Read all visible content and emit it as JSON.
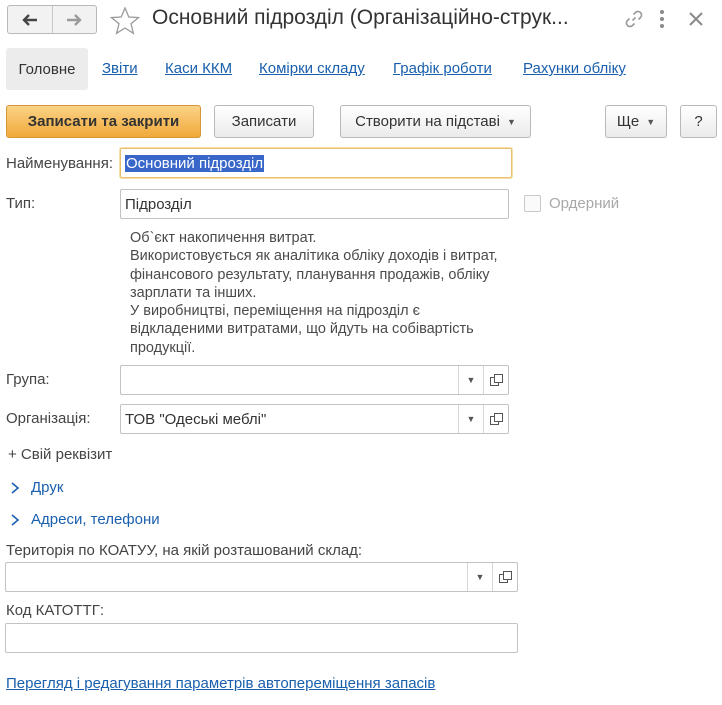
{
  "window": {
    "title": "Основний підрозділ (Організаційно-струк..."
  },
  "tabs": [
    {
      "label": "Головне",
      "active": true
    },
    {
      "label": "Звіти"
    },
    {
      "label": "Каси ККМ"
    },
    {
      "label": "Комірки складу"
    },
    {
      "label": "Графік роботи"
    },
    {
      "label": "Рахунки обліку"
    }
  ],
  "toolbar": {
    "save_close": "Записати та закрити",
    "save": "Записати",
    "create_based": "Створити на підставі",
    "more": "Ще",
    "help": "?"
  },
  "form": {
    "name_label": "Найменування:",
    "name_value": "Основний підрозділ",
    "type_label": "Тип:",
    "type_value": "Підрозділ",
    "orderly_label": "Ордерний",
    "orderly_checked": false,
    "description": "Об`єкт накопичення витрат.\nВикористовується як аналітика обліку доходів і витрат, фінансового результату, планування продажів, обліку зарплати та інших.\nУ виробництві, переміщення на підрозділ є відкладеними витратами, що йдуть на собівартість продукції.",
    "group_label": "Група:",
    "group_value": "",
    "org_label": "Організація:",
    "org_value": "ТОВ \"Одеські меблі\"",
    "custom_attr": "+ Свій реквізит",
    "print_section": "Друк",
    "addresses_section": "Адреси, телефони",
    "koatuu_label": "Територія по КОАТУУ, на якій розташований склад:",
    "koatuu_value": "",
    "katottg_label": "Код КАТОТТГ:",
    "katottg_value": "",
    "auto_move_link": "Перегляд і редагування параметрів автопереміщення запасів"
  },
  "colors": {
    "accent": "#f1a93a",
    "link": "#1a5fad",
    "selection": "#3967c9"
  }
}
